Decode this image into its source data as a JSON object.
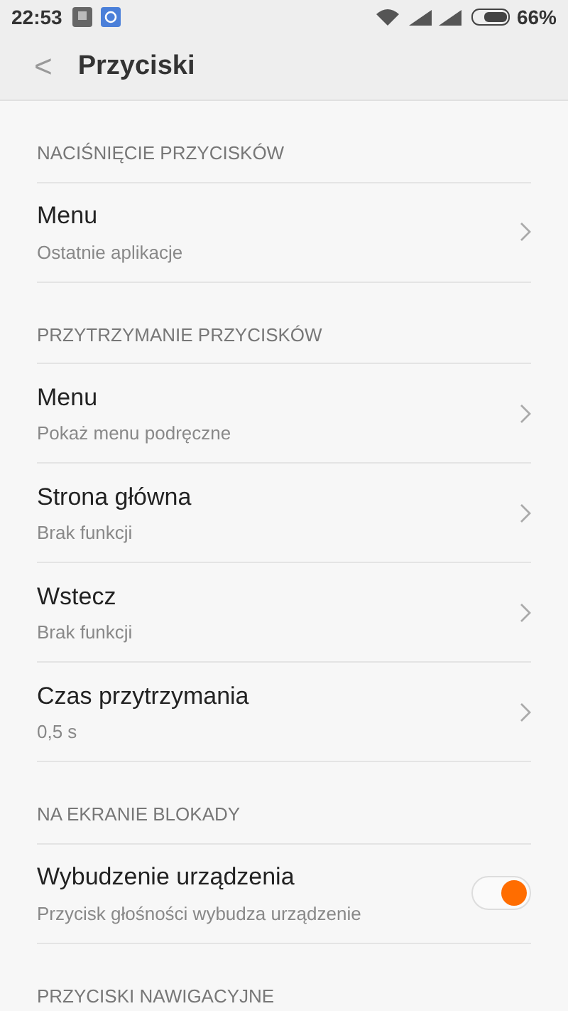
{
  "status_bar": {
    "time": "22:53",
    "battery": "66%"
  },
  "header": {
    "back": "<",
    "title": "Przyciski"
  },
  "sections": [
    {
      "title": "NACIŚNIĘCIE PRZYCISKÓW",
      "items": [
        {
          "kind": "link",
          "title": "Menu",
          "subtitle": "Ostatnie aplikacje"
        }
      ]
    },
    {
      "title": "PRZYTRZYMANIE PRZYCISKÓW",
      "items": [
        {
          "kind": "link",
          "title": "Menu",
          "subtitle": "Pokaż menu podręczne"
        },
        {
          "kind": "link",
          "title": "Strona główna",
          "subtitle": "Brak funkcji"
        },
        {
          "kind": "link",
          "title": "Wstecz",
          "subtitle": "Brak funkcji"
        },
        {
          "kind": "link",
          "title": "Czas przytrzymania",
          "subtitle": "0,5 s"
        }
      ]
    },
    {
      "title": "NA EKRANIE BLOKADY",
      "items": [
        {
          "kind": "toggle",
          "title": "Wybudzenie urządzenia",
          "subtitle": "Przycisk głośności wybudza urządzenie",
          "on": true
        }
      ]
    },
    {
      "title": "PRZYCISKI NAWIGACYJNE"
    }
  ]
}
